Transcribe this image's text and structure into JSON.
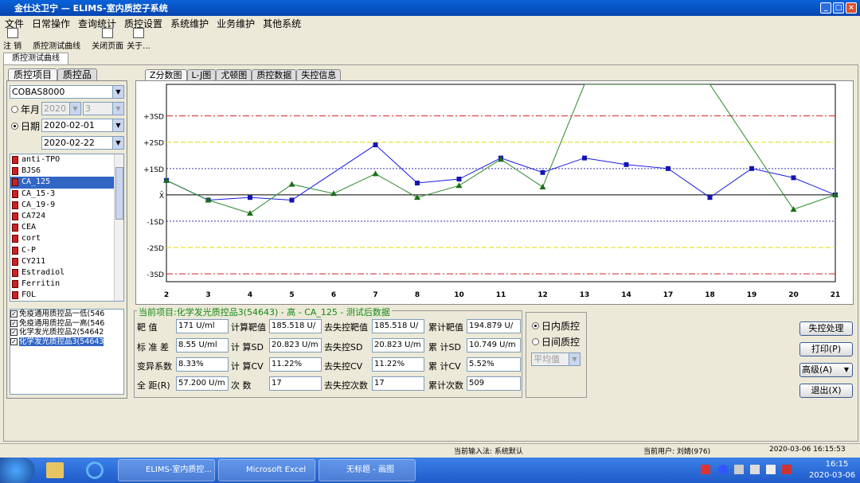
{
  "window": {
    "title": "金仕达卫宁 — ELIMS-室内质控子系统"
  },
  "menu": [
    "文件",
    "日常操作",
    "查询统计",
    "质控设置",
    "系统维护",
    "业务维护",
    "其他系统"
  ],
  "toolbar": {
    "logout": "注  销",
    "qc_curve": "质控测试曲线",
    "close_page": "关闭页面",
    "about": "关于..."
  },
  "page_tab": "质控测试曲线",
  "left": {
    "tabs": [
      "质控项目",
      "质控品"
    ],
    "instrument": "COBAS8000",
    "year_label": "年月",
    "year": "2020",
    "month": "3",
    "date_label": "日期",
    "date_from": "2020-02-01",
    "date_to": "2020-02-22",
    "items": [
      "anti-TPO",
      "BJS6",
      "CA_125",
      "CA_15-3",
      "CA_19-9",
      "CA724",
      "CEA",
      "cort",
      "C-P",
      "CY211",
      "Estradiol",
      "Ferritin",
      "FOL"
    ],
    "selected_item": "CA_125",
    "controls": [
      "免疫通用质控品一低(546",
      "免疫通用质控品一高(546",
      "化学发光质控品2(54642",
      "化学发光质控品3(54643"
    ]
  },
  "chart_tabs": [
    "Z分数图",
    "L-J图",
    "尤顿图",
    "质控数据",
    "失控信息"
  ],
  "chart_data": {
    "type": "line",
    "title": "",
    "y_labels": [
      "+3SD",
      "+2SD",
      "+1SD",
      "X̄",
      "-1SD",
      "-2SD",
      "-3SD"
    ],
    "ylim": [
      -3.3,
      4.2
    ],
    "categories": [
      "2",
      "3",
      "4",
      "5",
      "6",
      "7",
      "8",
      "10",
      "11",
      "12",
      "13",
      "14",
      "17",
      "18",
      "19",
      "20",
      "21"
    ],
    "series": [
      {
        "name": "",
        "color": "#1a1ae0",
        "values": [
          0.55,
          -0.2,
          -0.1,
          -0.2,
          null,
          1.9,
          0.45,
          0.6,
          1.4,
          0.85,
          1.4,
          1.15,
          1.0,
          -0.1,
          1.0,
          0.65,
          0.0
        ]
      },
      {
        "name": "",
        "color": "#2a8a2a",
        "values": [
          0.55,
          -0.2,
          -0.7,
          0.4,
          0.05,
          0.8,
          -0.1,
          0.35,
          1.35,
          0.3,
          4.2,
          null,
          null,
          4.2,
          null,
          -0.55,
          0.0
        ]
      }
    ]
  },
  "info": {
    "title": "当前项目:化学发光质控品3(54643) - 高 - CA_125 - 测试后数据",
    "target_label": "靶    值",
    "target": "171 U/ml",
    "calc_target_label": "计算靶值",
    "calc_target": "185.518 U/",
    "ooc_target_label": "去失控靶值",
    "ooc_target": "185.518 U/",
    "cum_target_label": "累计靶值",
    "cum_target": "194.879 U/",
    "sd_label": "标 准 差",
    "sd": "8.55 U/ml",
    "calc_sd_label": "计 算SD",
    "calc_sd": "20.823 U/m",
    "ooc_sd_label": "去失控SD",
    "ooc_sd": "20.823 U/m",
    "cum_sd_label": "累 计SD",
    "cum_sd": "10.749 U/m",
    "cv_label": "变异系数",
    "cv": "8.33%",
    "calc_cv_label": "计 算CV",
    "calc_cv": "11.22%",
    "ooc_cv_label": "去失控CV",
    "ooc_cv": "11.22%",
    "cum_cv_label": "累 计CV",
    "cum_cv": "5.52%",
    "range_label": "全 距(R)",
    "range": "57.200 U/m",
    "count_label": "次    数",
    "count": "17",
    "ooc_count_label": "去失控次数",
    "ooc_count": "17",
    "cum_count_label": "累计次数",
    "cum_count": "509"
  },
  "qc_mode": {
    "intra": "日内质控",
    "inter": "日间质控",
    "method": "平均值"
  },
  "buttons": {
    "ooc": "失控处理",
    "print": "打印(P)",
    "advanced": "高级(A)",
    "exit": "退出(X)"
  },
  "status": {
    "input": "当前输入法: 系统默认",
    "user": "当前用户: 刘婧(976)",
    "datetime": "2020-03-06 16:15:53"
  },
  "taskbar": {
    "items": [
      "ELIMS-室内质控...",
      "Microsoft Excel",
      "无标题 - 画图"
    ],
    "time": "16:15",
    "date": "2020-03-06"
  }
}
